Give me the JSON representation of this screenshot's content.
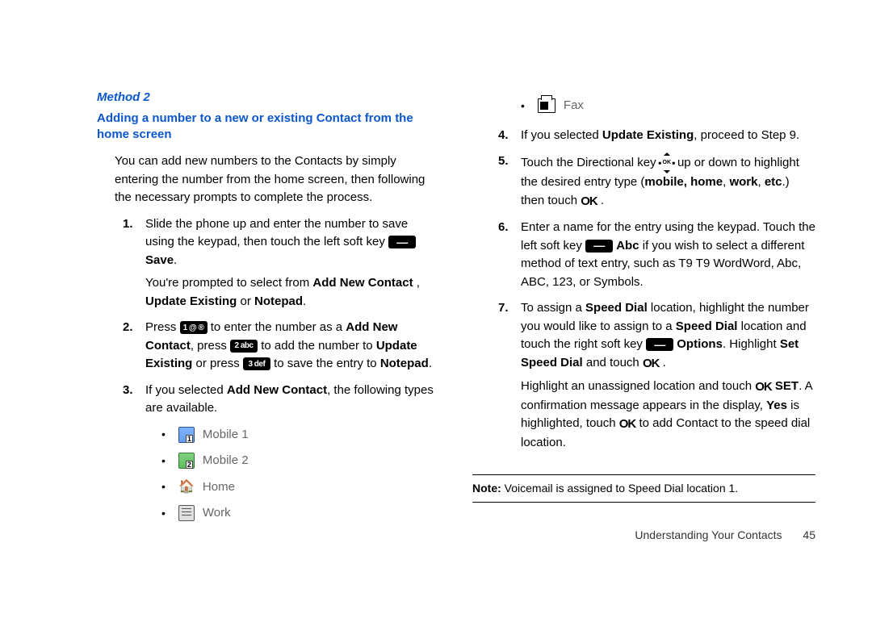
{
  "left": {
    "method_title": "Method 2",
    "subhead": "Adding a number to a new or existing Contact from the home screen",
    "intro": "You can add new numbers to the Contacts by simply entering the number from the home screen, then following the necessary prompts to complete the process.",
    "steps": {
      "s1a": "Slide the phone up and enter the number to save using the keypad, then touch the left soft key ",
      "s1b_bold": " Save",
      "s1c": ".",
      "s1d": "You're prompted to select from ",
      "s1d_b1": "Add New Contact",
      "s1e": " , ",
      "s1e_b2": "Update Existing",
      "s1f": " or ",
      "s1f_b3": "Notepad",
      "s1g": ".",
      "s2a": "Press ",
      "s2b": " to enter the number as a ",
      "s2b_b": "Add New Contact",
      "s2c": ", press ",
      "s2d": " to add the number to ",
      "s2d_b": "Update Existing",
      "s2e": " or press ",
      "s2f": " to save the entry to ",
      "s2f_b": "Notepad",
      "s2g": ".",
      "s3a": "If you selected ",
      "s3a_b": "Add New Contact",
      "s3b": ", the following types are available.",
      "types": {
        "t1": "Mobile 1",
        "t2": "Mobile 2",
        "t3": "Home",
        "t4": "Work"
      }
    }
  },
  "right": {
    "fax": "Fax",
    "s4a": "If you selected ",
    "s4a_b": "Update Existing",
    "s4b": ", proceed to Step 9.",
    "s5a": "Touch the Directional key ",
    "s5b": " up or down to highlight the desired entry type (",
    "s5b_b": "mobile, home",
    "s5c": ", ",
    "s5c_b": "work",
    "s5d": ", ",
    "s5d_b": "etc",
    "s5e": ".) then touch ",
    "s5ok": "OK",
    "s5f": " .",
    "s6a": "Enter a name for the entry using the keypad. Touch the left soft key ",
    "s6a_b": " Abc",
    "s6b": " if you wish to select a different method of text entry, such as T9 T9 WordWord, Abc, ABC, 123, or Symbols.",
    "s7a": "To assign a ",
    "s7a_b": "Speed Dial",
    "s7b": " location, highlight the number you would like to assign to a ",
    "s7b_b": "Speed Dial",
    "s7c": " location and touch the right soft key ",
    "s7c_b": " Options",
    "s7d": ". Highlight ",
    "s7d_b": "Set Speed Dial",
    "s7e": " and touch ",
    "s7ok": "OK",
    "s7f": " .",
    "s7g": "Highlight an unassigned location and touch ",
    "s7g_ok": "OK",
    "s7g_b": " SET",
    "s7h": ". A confirmation message appears in the display, ",
    "s7h_b": "Yes",
    "s7i": " is highlighted, touch ",
    "s7i_ok": "OK",
    "s7j": " to add Contact to the speed dial location.",
    "note_b": "Note:",
    "note": " Voicemail is assigned to Speed Dial location 1.",
    "footer_section": "Understanding Your Contacts",
    "footer_page": "45"
  },
  "keys": {
    "k1": "1 @ ®",
    "k2": "2 abc",
    "k3": "3 def"
  }
}
